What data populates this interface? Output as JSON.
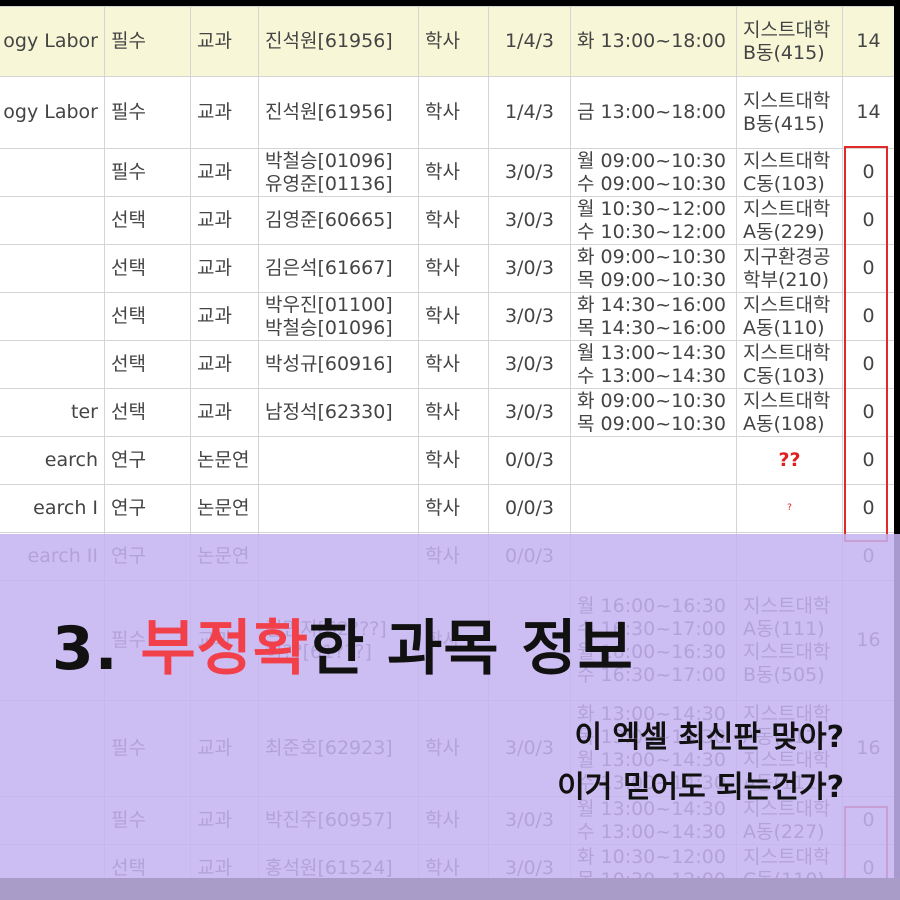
{
  "rows": [
    {
      "name": "ogy Labor",
      "type": "필수",
      "cat": "교과",
      "prof": "진석원[61956]",
      "dept": "학사",
      "credit": "1/4/3",
      "time": "화 13:00~18:00",
      "room": "지스트대학\nB동(415)",
      "num": "14",
      "lab": true
    },
    {
      "name": "ogy Labor",
      "type": "필수",
      "cat": "교과",
      "prof": "진석원[61956]",
      "dept": "학사",
      "credit": "1/4/3",
      "time": "금 13:00~18:00",
      "room": "지스트대학\nB동(415)",
      "num": "14",
      "lab": false
    },
    {
      "name": "",
      "type": "필수",
      "cat": "교과",
      "prof": "박철승[01096]\n유영준[01136]",
      "dept": "학사",
      "credit": "3/0/3",
      "time": "월 09:00~10:30\n수 09:00~10:30",
      "room": "지스트대학\nC동(103)",
      "num": "0"
    },
    {
      "name": "",
      "type": "선택",
      "cat": "교과",
      "prof": "김영준[60665]",
      "dept": "학사",
      "credit": "3/0/3",
      "time": "월 10:30~12:00\n수 10:30~12:00",
      "room": "지스트대학\nA동(229)",
      "num": "0"
    },
    {
      "name": "",
      "type": "선택",
      "cat": "교과",
      "prof": "김은석[61667]",
      "dept": "학사",
      "credit": "3/0/3",
      "time": "화 09:00~10:30\n목 09:00~10:30",
      "room": "지구환경공\n학부(210)",
      "num": "0"
    },
    {
      "name": "",
      "type": "선택",
      "cat": "교과",
      "prof": "박우진[01100]\n박철승[01096]",
      "dept": "학사",
      "credit": "3/0/3",
      "time": "화 14:30~16:00\n목 14:30~16:00",
      "room": "지스트대학\nA동(110)",
      "num": "0"
    },
    {
      "name": "",
      "type": "선택",
      "cat": "교과",
      "prof": "박성규[60916]",
      "dept": "학사",
      "credit": "3/0/3",
      "time": "월 13:00~14:30\n수 13:00~14:30",
      "room": "지스트대학\nC동(103)",
      "num": "0"
    },
    {
      "name": "ter",
      "type": "선택",
      "cat": "교과",
      "prof": "남정석[62330]",
      "dept": "학사",
      "credit": "3/0/3",
      "time": "화 09:00~10:30\n목 09:00~10:30",
      "room": "지스트대학\nA동(108)",
      "num": "0"
    },
    {
      "name": "earch",
      "type": "연구",
      "cat": "논문연",
      "prof": "",
      "dept": "학사",
      "credit": "0/0/3",
      "time": "",
      "room": "",
      "num": "0"
    },
    {
      "name": "earch I",
      "type": "연구",
      "cat": "논문연",
      "prof": "",
      "dept": "학사",
      "credit": "0/0/3",
      "time": "",
      "room": "",
      "num": "0"
    },
    {
      "name": "earch II",
      "type": "연구",
      "cat": "논문연",
      "prof": "",
      "dept": "학사",
      "credit": "0/0/3",
      "time": "",
      "room": "",
      "num": "0"
    },
    {
      "name": "",
      "type": "필수",
      "cat": "교과",
      "prof": "김민지[62???]\n이??[61???]",
      "dept": "학사",
      "credit": "",
      "time": "월 16:00~16:30\n수 16:30~17:00\n월 16:00~16:30\n수 16:30~17:00",
      "room": "지스트대학\nA동(111)\n지스트대학\nB동(505)",
      "num": "16"
    },
    {
      "name": "",
      "type": "필수",
      "cat": "교과",
      "prof": "최준호[62923]",
      "dept": "학사",
      "credit": "3/0/3",
      "time": "화 13:00~14:30\n목 13:00~14:30\n월 13:00~14:30\n수 13:00~14:30",
      "room": "지스트대학\nA동(111)\n지스트대학\nA동(111)",
      "num": "16"
    },
    {
      "name": "",
      "type": "필수",
      "cat": "교과",
      "prof": "박진주[60957]",
      "dept": "학사",
      "credit": "3/0/3",
      "time": "월 13:00~14:30\n수 13:00~14:30",
      "room": "지스트대학\nA동(227)",
      "num": "0"
    },
    {
      "name": "",
      "type": "선택",
      "cat": "교과",
      "prof": "홍석원[61524]",
      "dept": "학사",
      "credit": "3/0/3",
      "time": "화 10:30~12:00\n목 10:30~12:00",
      "room": "지스트대학\nC동(110)",
      "num": "0"
    }
  ],
  "annotations": {
    "row9_mark": "??",
    "row10_mark": "?"
  },
  "headline": {
    "num": "3.",
    "accent": "부정확",
    "rest": "한 과목 정보"
  },
  "subtitle": {
    "line1": "이 엑셀 최신판 맞아?",
    "line2": "이거 믿어도 되는건가?"
  },
  "colors": {
    "accent": "#f2404a",
    "overlay": "#c4b2f0",
    "highlight_box": "#e02a2a",
    "lab_row": "#f7f7d8"
  }
}
